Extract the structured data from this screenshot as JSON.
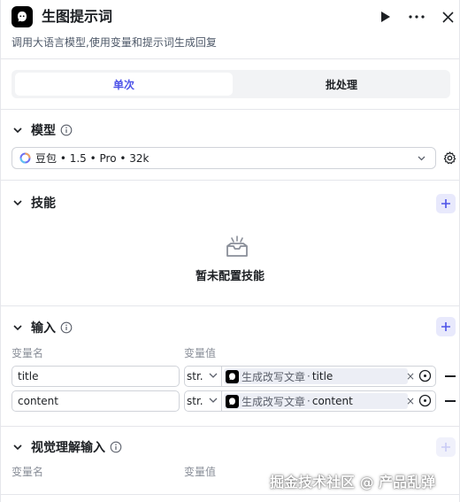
{
  "header": {
    "title": "生图提示词",
    "description": "调用大语言模型,使用变量和提示词生成回复",
    "icons": [
      "play-icon",
      "more-icon",
      "close-icon"
    ]
  },
  "tabs": [
    {
      "label": "单次",
      "active": true
    },
    {
      "label": "批处理",
      "active": false
    }
  ],
  "model": {
    "section_title": "模型",
    "selected": "豆包 • 1.5 • Pro • 32k"
  },
  "skills": {
    "section_title": "技能",
    "empty_text": "暂未配置技能"
  },
  "inputs": {
    "section_title": "输入",
    "col_name": "变量名",
    "col_value": "变量值",
    "rows": [
      {
        "name": "title",
        "type": "str.",
        "ref_source": "生成改写文章",
        "ref_var": "title"
      },
      {
        "name": "content",
        "type": "str.",
        "ref_source": "生成改写文章",
        "ref_var": "content"
      }
    ]
  },
  "vision": {
    "section_title": "视觉理解输入",
    "col_name": "变量名",
    "col_value": "变量值"
  },
  "watermark": "掘金技术社区 @ 产品乱弹",
  "colors": {
    "accent": "#4d53e8",
    "border": "#e5e6eb"
  }
}
